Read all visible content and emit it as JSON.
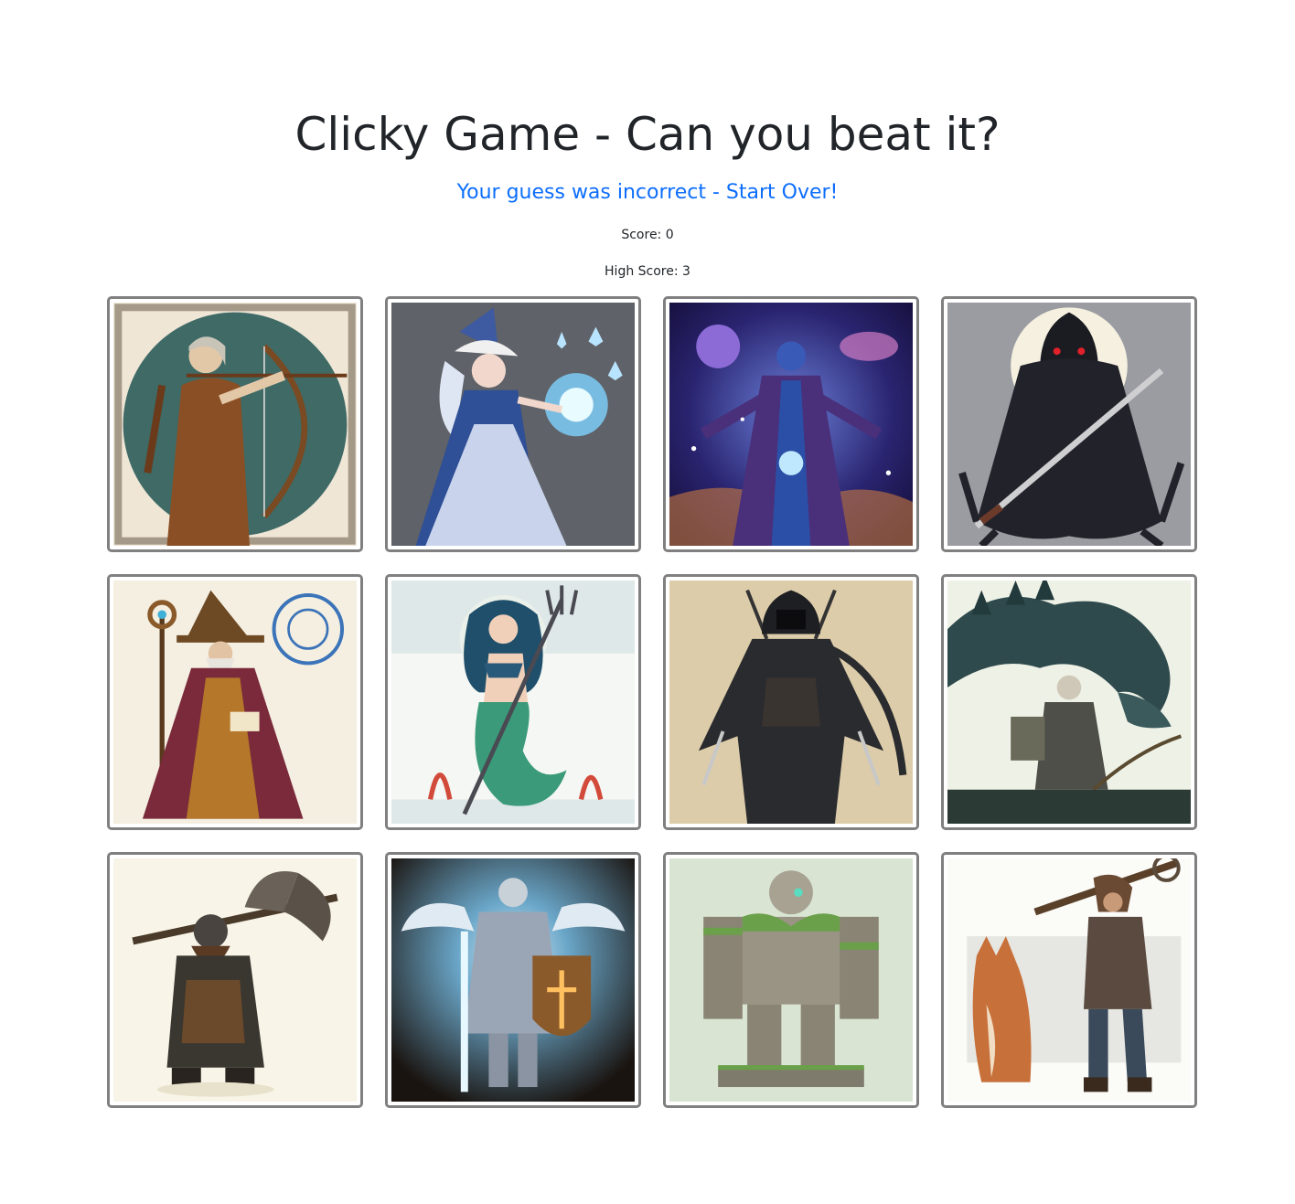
{
  "header": {
    "title": "Clicky Game - Can you beat it?",
    "message": "Your guess was incorrect - Start Over!",
    "score_text": "Score: 0",
    "high_score_text": "High Score: 3"
  },
  "cards": [
    {
      "name": "elf-archer-card",
      "icon": "elf-archer-image"
    },
    {
      "name": "ice-sorceress-card",
      "icon": "ice-sorceress-image"
    },
    {
      "name": "cosmic-mage-card",
      "icon": "cosmic-mage-image"
    },
    {
      "name": "shadow-reaper-card",
      "icon": "shadow-reaper-image"
    },
    {
      "name": "wizard-card",
      "icon": "wizard-image"
    },
    {
      "name": "mermaid-card",
      "icon": "mermaid-image"
    },
    {
      "name": "assassin-card",
      "icon": "assassin-image"
    },
    {
      "name": "dragon-rider-card",
      "icon": "dragon-rider-image"
    },
    {
      "name": "dwarf-warrior-card",
      "icon": "dwarf-warrior-image"
    },
    {
      "name": "paladin-card",
      "icon": "paladin-image"
    },
    {
      "name": "stone-golem-card",
      "icon": "stone-golem-image"
    },
    {
      "name": "ranger-with-dog-card",
      "icon": "ranger-with-dog-image"
    }
  ],
  "colors": {
    "message": "#0d6efd",
    "card_border": "#808080",
    "text": "#212529"
  }
}
